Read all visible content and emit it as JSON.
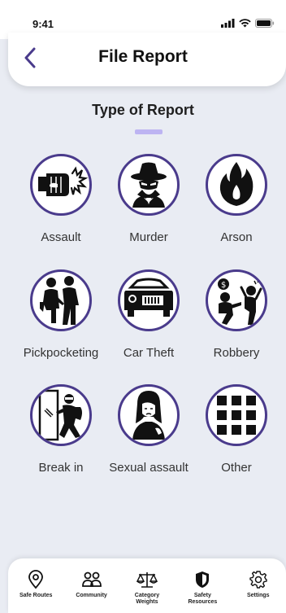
{
  "status_bar": {
    "time": "9:41"
  },
  "header": {
    "title": "File Report"
  },
  "section": {
    "title": "Type of Report"
  },
  "report_types": [
    {
      "label": "Assault",
      "icon": "fist-punch-icon"
    },
    {
      "label": "Murder",
      "icon": "spy-icon"
    },
    {
      "label": "Arson",
      "icon": "fire-icon"
    },
    {
      "label": "Pickpocketing",
      "icon": "pickpocket-icon"
    },
    {
      "label": "Car Theft",
      "icon": "car-icon"
    },
    {
      "label": "Robbery",
      "icon": "robbery-icon"
    },
    {
      "label": "Break in",
      "icon": "burglar-icon"
    },
    {
      "label": "Sexual assault",
      "icon": "woman-distress-icon"
    },
    {
      "label": "Other",
      "icon": "grid-squares-icon"
    }
  ],
  "tabbar": {
    "items": [
      {
        "label": "Safe Routes",
        "icon": "location-pin-icon"
      },
      {
        "label": "Community",
        "icon": "people-icon"
      },
      {
        "label": "Category\nWeights",
        "icon": "scales-icon"
      },
      {
        "label": "Safety\nResources",
        "icon": "shield-icon"
      },
      {
        "label": "Settings",
        "icon": "gear-icon"
      }
    ]
  },
  "colors": {
    "accent": "#4a3b8c",
    "underline": "#bdb4f2",
    "background": "#e9ecf3"
  }
}
